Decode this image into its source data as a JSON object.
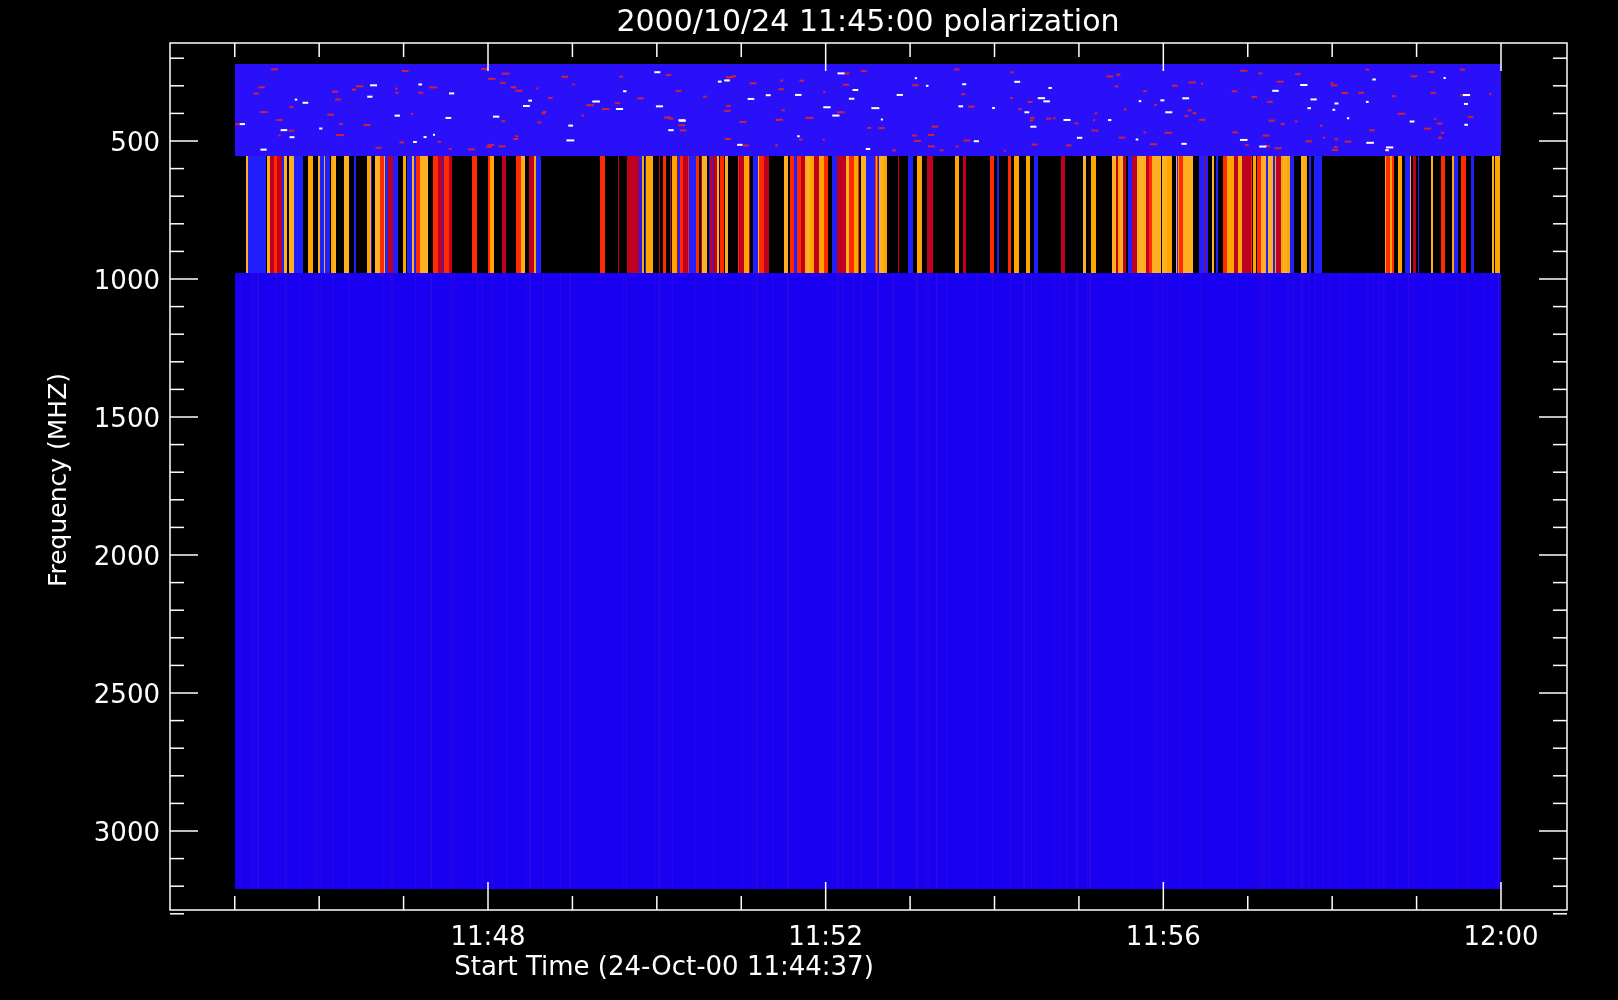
{
  "title": "2000/10/24 11:45:00 polarization",
  "ylabel": "Frequency (MHZ)",
  "xlabel": "Start Time (24-Oct-00 11:44:37)",
  "yticks": [
    "500",
    "1000",
    "1500",
    "2000",
    "2500",
    "3000"
  ],
  "xticks": [
    "11:48",
    "11:52",
    "11:56",
    "12:00"
  ]
}
